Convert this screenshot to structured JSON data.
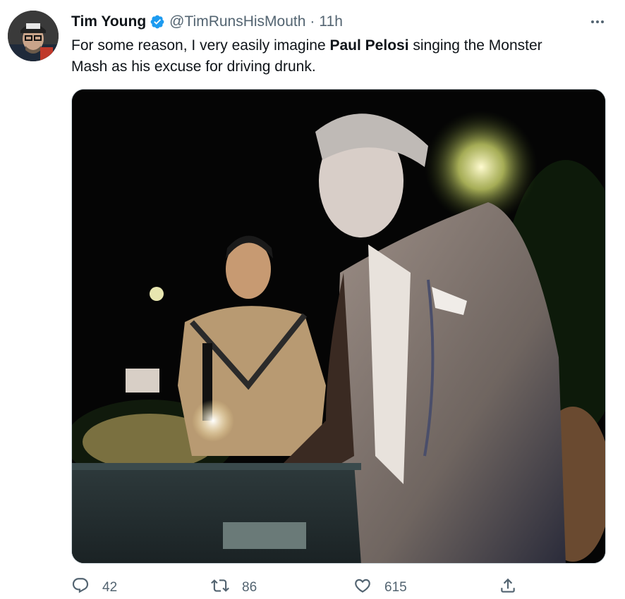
{
  "author": {
    "display_name": "Tim Young",
    "handle": "@TimRunsHisMouth",
    "separator": "·",
    "time": "11h",
    "verified": true
  },
  "tweet": {
    "text_before": "For some reason, I very easily imagine ",
    "text_bold": "Paul Pelosi",
    "text_after": " singing the Monster Mash as his excuse for driving drunk."
  },
  "actions": {
    "reply_count": "42",
    "retweet_count": "86",
    "like_count": "615"
  },
  "icons": {
    "more": "more-horizontal-icon",
    "verified": "verified-badge-icon",
    "reply": "reply-icon",
    "retweet": "retweet-icon",
    "like": "heart-icon",
    "share": "share-icon"
  },
  "colors": {
    "verified": "#1d9bf0",
    "secondary_text": "#536471",
    "primary_text": "#0f1419"
  }
}
